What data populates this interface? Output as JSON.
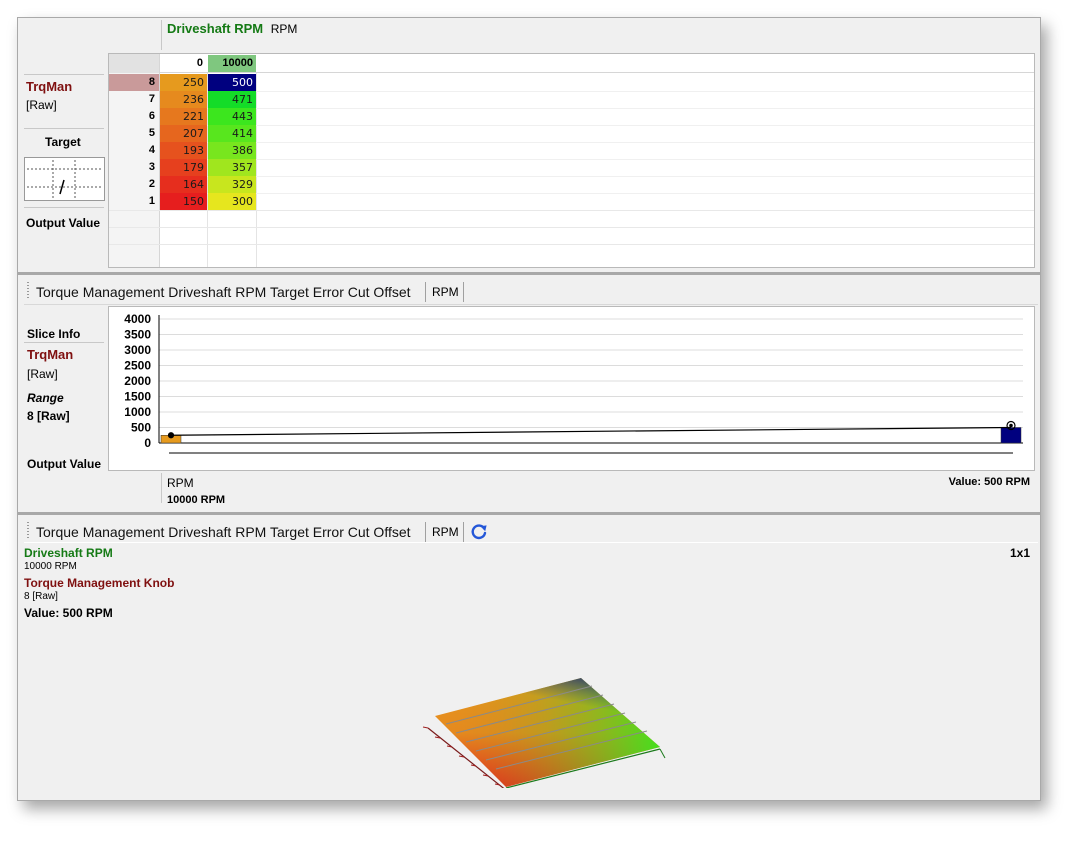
{
  "top": {
    "axis_title": "Driveshaft RPM",
    "axis_unit": "RPM",
    "side_name": "TrqMan",
    "side_unit": "[Raw]",
    "target_label": "Target",
    "output_label": "Output Value",
    "col_headers": [
      "0",
      "10000"
    ],
    "rows": [
      {
        "hdr": "8",
        "v0": "250",
        "v1": "500",
        "c0": "#e69a1e",
        "c1": "#00007f"
      },
      {
        "hdr": "7",
        "v0": "236",
        "v1": "471",
        "c0": "#e68a1e",
        "c1": "#14dc28"
      },
      {
        "hdr": "6",
        "v0": "221",
        "v1": "443",
        "c0": "#e6781e",
        "c1": "#3ce61e"
      },
      {
        "hdr": "5",
        "v0": "207",
        "v1": "414",
        "c0": "#e6661e",
        "c1": "#58e61e"
      },
      {
        "hdr": "4",
        "v0": "193",
        "v1": "386",
        "c0": "#e6521e",
        "c1": "#78e61e"
      },
      {
        "hdr": "3",
        "v0": "179",
        "v1": "357",
        "c0": "#e6401e",
        "c1": "#a0e61e"
      },
      {
        "hdr": "2",
        "v0": "164",
        "v1": "329",
        "c0": "#e62e1e",
        "c1": "#c8e61e"
      },
      {
        "hdr": "1",
        "v0": "150",
        "v1": "300",
        "c0": "#e61e1e",
        "c1": "#e6e61e"
      }
    ]
  },
  "middle": {
    "title": "Torque Management Driveshaft RPM Target Error Cut Offset",
    "unit": "RPM",
    "slice_info": "Slice Info",
    "side_name": "TrqMan",
    "side_unit": "[Raw]",
    "range_label": "Range",
    "range_value": "8 [Raw]",
    "output_label": "Output Value",
    "x_unit": "RPM",
    "x_value": "10000 RPM",
    "value_readout": "Value: 500 RPM"
  },
  "chart_data": {
    "type": "line",
    "x": [
      0,
      10000
    ],
    "values": [
      250,
      500
    ],
    "yticks": [
      "4000",
      "3500",
      "3000",
      "2500",
      "2000",
      "1500",
      "1000",
      "500",
      "0"
    ],
    "ylim": [
      0,
      4000
    ],
    "grid": true,
    "start_color": "#e69a1e",
    "end_color": "#00007f"
  },
  "bottom": {
    "title": "Torque Management Driveshaft RPM Target Error Cut Offset",
    "unit": "RPM",
    "axis1_name": "Driveshaft RPM",
    "axis1_value": "10000 RPM",
    "axis2_name": "Torque Management Knob",
    "axis2_value": "8 [Raw]",
    "value": "Value: 500 RPM",
    "size": "1x1"
  },
  "icons": {
    "refresh": "refresh-icon",
    "target": "target-crosshair-icon"
  }
}
